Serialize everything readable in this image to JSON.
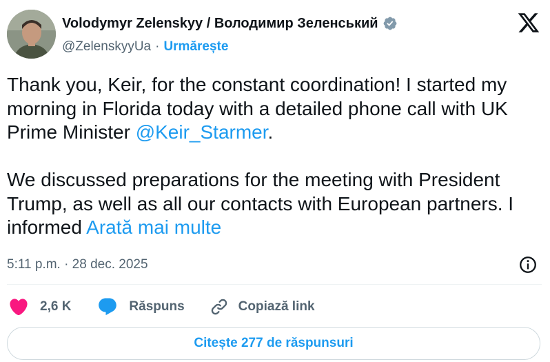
{
  "author": {
    "display_name": "Volodymyr Zelenskyy / Володимир Зеленський",
    "handle": "@ZelenskyyUa",
    "separator": "·",
    "follow_label": "Urmărește"
  },
  "tweet": {
    "para1_text": "Thank you, Keir, for the constant coordination! I started my morning in Florida today with a detailed phone call with UK Prime Minister ",
    "mention": "@Keir_Starmer",
    "para1_end": ".",
    "para2_text": "We discussed preparations for the meeting with President Trump, as well as all our contacts with European partners. I informed ",
    "show_more": "Arată mai multe"
  },
  "timestamp": "5:11 p.m. · 28 dec. 2025",
  "actions": {
    "likes": "2,6 K",
    "reply_label": "Răspuns",
    "copy_link_label": "Copiază link"
  },
  "read_replies_label": "Citește 277 de răspunsuri",
  "colors": {
    "accent": "#1d9bf0",
    "like": "#f91880",
    "text": "#0f1419",
    "muted": "#536471"
  },
  "icons": [
    "avatar",
    "verified-badge-icon",
    "x-logo-icon",
    "info-icon",
    "heart-icon",
    "reply-bubble-icon",
    "link-icon"
  ]
}
